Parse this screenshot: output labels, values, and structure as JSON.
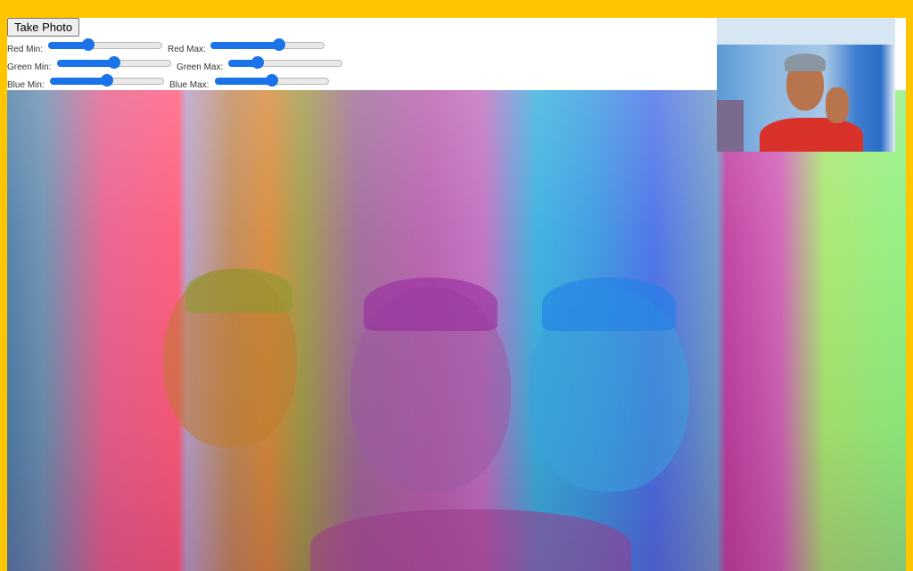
{
  "take_photo_label": "Take Photo",
  "sliders": {
    "red_min": {
      "label": "Red Min:",
      "value": 0.35
    },
    "red_max": {
      "label": "Red Max:",
      "value": 0.6
    },
    "green_min": {
      "label": "Green Min:",
      "value": 0.5
    },
    "green_max": {
      "label": "Green Max:",
      "value": 0.26
    },
    "blue_min": {
      "label": "Blue Min:",
      "value": 0.5
    },
    "blue_max": {
      "label": "Blue Max:",
      "value": 0.5
    }
  },
  "colors": {
    "page_background": "#ffc600",
    "slider_accent": "#1a73e8"
  }
}
